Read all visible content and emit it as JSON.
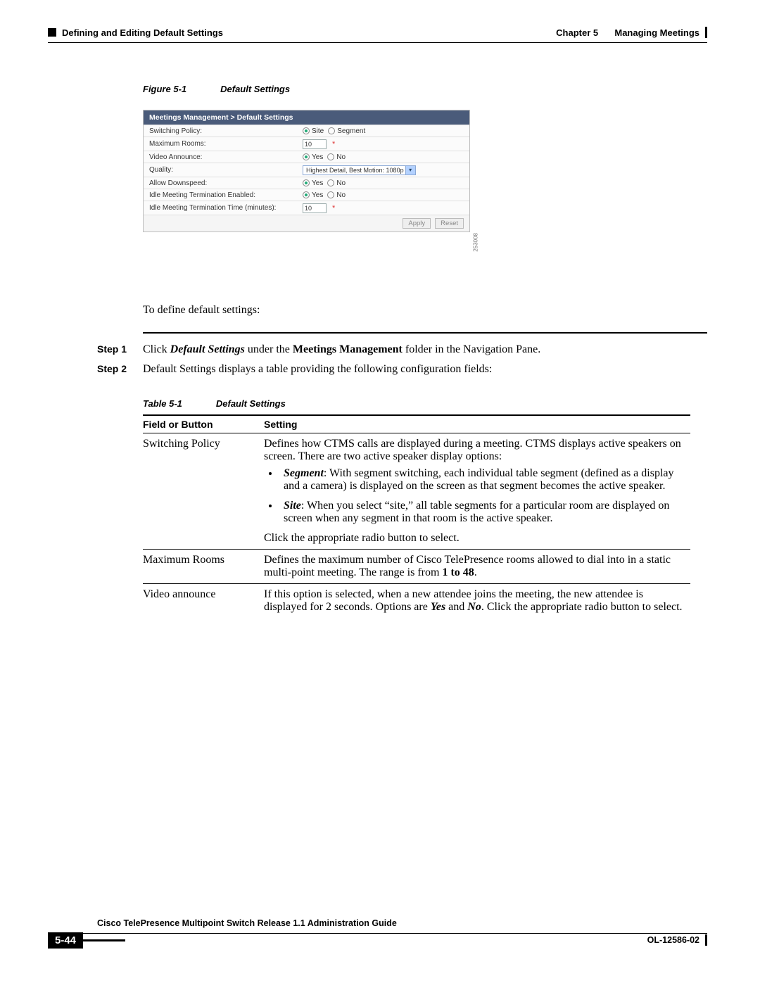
{
  "header": {
    "left_section": "Defining and Editing Default Settings",
    "chapter": "Chapter 5",
    "chapter_title": "Managing Meetings"
  },
  "figure": {
    "label": "Figure 5-1",
    "title": "Default Settings"
  },
  "screenshot": {
    "breadcrumb": "Meetings Management > Default Settings",
    "img_id": "253008",
    "rows": {
      "switching_policy": {
        "label": "Switching Policy:",
        "opt1": "Site",
        "opt2": "Segment"
      },
      "max_rooms": {
        "label": "Maximum Rooms:",
        "value": "10"
      },
      "video_announce": {
        "label": "Video Announce:",
        "yes": "Yes",
        "no": "No"
      },
      "quality": {
        "label": "Quality:",
        "value": "Highest Detail, Best Motion: 1080p"
      },
      "allow_downspeed": {
        "label": "Allow Downspeed:",
        "yes": "Yes",
        "no": "No"
      },
      "idle_enabled": {
        "label": "Idle Meeting Termination Enabled:",
        "yes": "Yes",
        "no": "No"
      },
      "idle_time": {
        "label": "Idle Meeting Termination Time (minutes):",
        "value": "10"
      }
    },
    "apply": "Apply",
    "reset": "Reset"
  },
  "intro": "To define default settings:",
  "steps": {
    "s1_label": "Step 1",
    "s1_a": "Click ",
    "s1_b": "Default Settings",
    "s1_c": " under the ",
    "s1_d": "Meetings Management",
    "s1_e": " folder in the Navigation Pane.",
    "s2_label": "Step 2",
    "s2_text": "Default Settings displays a table providing the following configuration fields:"
  },
  "table_caption": {
    "label": "Table 5-1",
    "title": "Default Settings"
  },
  "table": {
    "head1": "Field or Button",
    "head2": "Setting",
    "switching": {
      "name": "Switching Policy",
      "p1": "Defines how CTMS calls are displayed during a meeting. CTMS displays active speakers on screen. There are two active speaker display options:",
      "b1_head": "Segment",
      "b1_text": ": With segment switching, each individual table segment (defined as a display and a camera) is displayed on the screen as that segment becomes the active speaker.",
      "b2_head": "Site",
      "b2_text": ": When you select “site,” all table segments for a particular room are displayed on screen when any segment in that room is the active speaker.",
      "p2": "Click the appropriate radio button to select."
    },
    "maxrooms": {
      "name": "Maximum Rooms",
      "p_a": "Defines the maximum number of Cisco TelePresence rooms allowed to dial into in a static multi-point meeting. The range is from ",
      "p_b": "1 to 48",
      "p_c": "."
    },
    "video": {
      "name": "Video announce",
      "p_a": "If this option is selected, when a new attendee joins the meeting, the new attendee is displayed for 2 seconds. Options are ",
      "p_b": "Yes",
      "p_c": " and ",
      "p_d": "No",
      "p_e": ". Click the appropriate radio button to select."
    }
  },
  "footer": {
    "guide": "Cisco TelePresence Multipoint Switch Release 1.1 Administration Guide",
    "page": "5-44",
    "doc_id": "OL-12586-02"
  }
}
